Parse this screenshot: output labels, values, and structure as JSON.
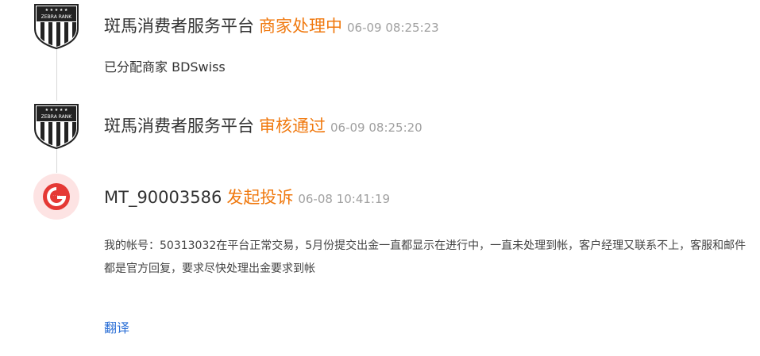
{
  "colors": {
    "action_orange": "#f0790f",
    "link_blue": "#2b6fd6",
    "badge_red": "#e53935"
  },
  "entries": [
    {
      "avatar_icon": "zebra-rank-shield-icon",
      "avatar_text": "ZEBRA RANK",
      "actor": "斑馬消费者服务平台",
      "action": "商家处理中",
      "time": "06-09 08:25:23",
      "body": "已分配商家 BDSwiss"
    },
    {
      "avatar_icon": "zebra-rank-shield-icon",
      "avatar_text": "ZEBRA RANK",
      "actor": "斑馬消费者服务平台",
      "action": "审核通过",
      "time": "06-09 08:25:20"
    },
    {
      "avatar_icon": "user-badge-icon",
      "actor": "MT_90003586",
      "action": "发起投诉",
      "time": "06-08 10:41:19",
      "body": "我的帐号：50313032在平台正常交易，5月份提交出金一直都显示在进行中，一直未处理到帐，客户经理又联系不上，客服和邮件都是官方回复，要求尽快处理出金要求到帐"
    }
  ],
  "translate_label": "翻译"
}
